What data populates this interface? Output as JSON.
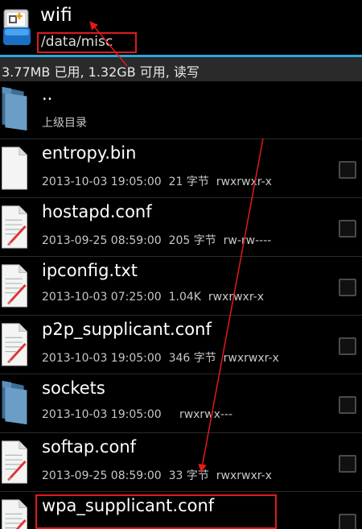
{
  "header": {
    "title": "wifi",
    "path": "/data/misc",
    "app_icon": "file-manager-icon"
  },
  "status": {
    "text": "3.77MB 已用, 1.32GB 可用, 读写"
  },
  "files": [
    {
      "name": "..",
      "meta": "上级目录",
      "icon": "folder-icon",
      "has_checkbox": false
    },
    {
      "name": "entropy.bin",
      "meta": "2013-10-03 19:05:00  21 字节  rwxrwxr-x",
      "icon": "blank-file-icon",
      "has_checkbox": true
    },
    {
      "name": "hostapd.conf",
      "meta": "2013-09-25 08:59:00  205 字节  rw-rw----",
      "icon": "text-file-icon",
      "has_checkbox": true
    },
    {
      "name": "ipconfig.txt",
      "meta": "2013-10-03 07:25:00  1.04K  rwxrwxr-x",
      "icon": "text-file-icon",
      "has_checkbox": true
    },
    {
      "name": "p2p_supplicant.conf",
      "meta": "2013-10-03 19:05:00  346 字节  rwxrwxr-x",
      "icon": "text-file-icon",
      "has_checkbox": true
    },
    {
      "name": "sockets",
      "meta": "2013-10-03 19:05:00     rwxrwx---",
      "icon": "folder-icon",
      "has_checkbox": true
    },
    {
      "name": "softap.conf",
      "meta": "2013-09-25 08:59:00  33 字节  rwxrwxr-x",
      "icon": "text-file-icon",
      "has_checkbox": true
    },
    {
      "name": "wpa_supplicant.conf",
      "meta": "",
      "icon": "text-file-icon",
      "has_checkbox": true
    }
  ],
  "colors": {
    "accent": "#2aa7e0",
    "annotation": "#e21a1a",
    "status_bar": "#2a2a2a",
    "background": "#000000"
  }
}
